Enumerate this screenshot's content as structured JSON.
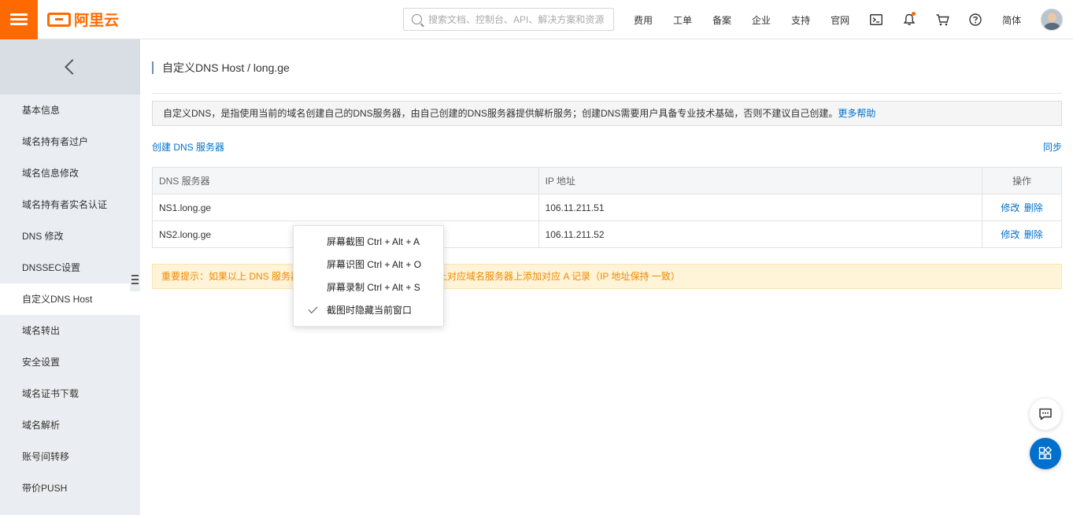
{
  "topbar": {
    "logo_text": "阿里云",
    "search_placeholder": "搜索文档、控制台、API、解决方案和资源",
    "nav": [
      "费用",
      "工单",
      "备案",
      "企业",
      "支持",
      "官网"
    ],
    "language": "简体",
    "icons": [
      "terminal-icon",
      "bell-icon",
      "cart-icon",
      "help-icon"
    ],
    "accent_color": "#ff6a00"
  },
  "sidebar": {
    "items": [
      {
        "label": "基本信息"
      },
      {
        "label": "域名持有者过户"
      },
      {
        "label": "域名信息修改"
      },
      {
        "label": "域名持有者实名认证"
      },
      {
        "label": "DNS 修改"
      },
      {
        "label": "DNSSEC设置"
      },
      {
        "label": "自定义DNS Host"
      },
      {
        "label": "域名转出"
      },
      {
        "label": "安全设置"
      },
      {
        "label": "域名证书下载"
      },
      {
        "label": "域名解析"
      },
      {
        "label": "账号间转移"
      },
      {
        "label": "带价PUSH"
      }
    ],
    "active_item": "自定义DNS Host"
  },
  "main": {
    "title": "自定义DNS Host / long.ge",
    "notice_text": "自定义DNS，是指使用当前的域名创建自己的DNS服务器，由自己创建的DNS服务器提供解析服务；创建DNS需要用户具备专业技术基础，否则不建议自己创建。",
    "notice_link": "更多帮助",
    "create_link": "创建 DNS 服务器",
    "sync_link": "同步",
    "table": {
      "headers": [
        "DNS 服务器",
        "IP 地址",
        "操作"
      ],
      "rows": [
        {
          "server": "NS1.long.ge",
          "ip": "106.11.211.51",
          "edit": "修改",
          "delete": "删除"
        },
        {
          "server": "NS2.long.ge",
          "ip": "106.11.211.52",
          "edit": "修改",
          "delete": "删除"
        }
      ]
    },
    "warning": "重要提示：如果以上 DNS 服务器已用于解析，请在对应域名服务器上添加对应 A 记录（IP 地址保持 一致）",
    "warning_visible_left": "重要提示：如果以上 DNS 服务器",
    "warning_visible_right": "上对应域名服务器上添加对应 A 记录（IP 地址保持 一致）"
  },
  "context_menu": {
    "items": [
      {
        "label": "屏幕截图 Ctrl + Alt + A",
        "checked": false
      },
      {
        "label": "屏幕识图 Ctrl + Alt + O",
        "checked": false
      },
      {
        "label": "屏幕录制 Ctrl + Alt + S",
        "checked": false
      },
      {
        "label": "截图时隐藏当前窗口",
        "checked": true
      }
    ]
  },
  "fabs": [
    "chat-icon",
    "apps-icon"
  ]
}
